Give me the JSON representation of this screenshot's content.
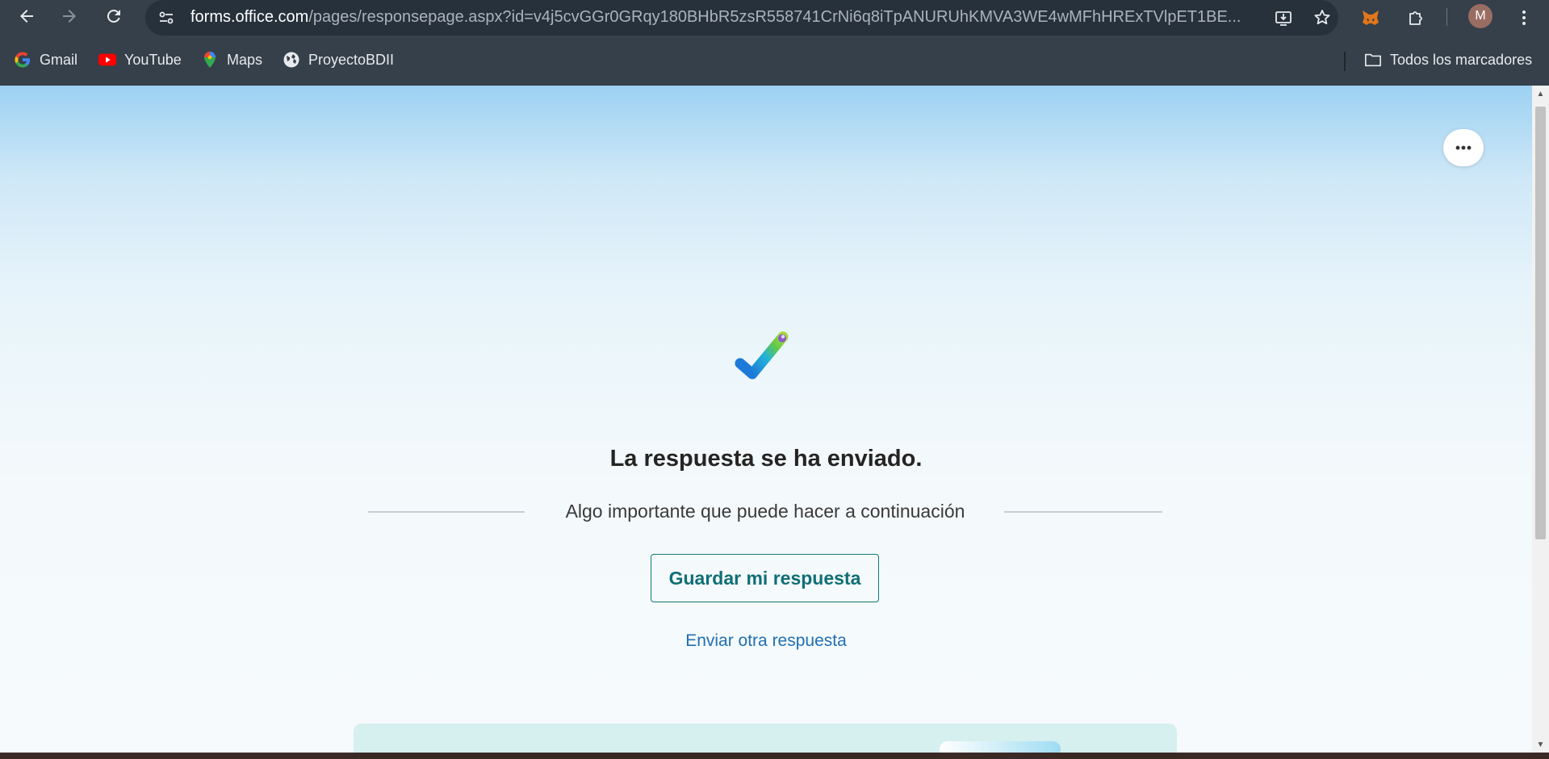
{
  "browser": {
    "url_host": "forms.office.com",
    "url_path": "/pages/responsepage.aspx?id=v4j5cvGGr0GRqy180BHbR5zsR558741CrNi6q8iTpANURUhKMVA3WE4wMFhHRExTVlpET1BE...",
    "profile_initial": "M",
    "icons": [
      "back-icon",
      "forward-icon",
      "reload-icon",
      "site-info-icon",
      "install-app-icon",
      "star-icon",
      "metamask-icon",
      "extensions-icon",
      "chrome-menu-icon"
    ]
  },
  "bookmarks": {
    "items": [
      {
        "label": "Gmail",
        "icon": "google-icon"
      },
      {
        "label": "YouTube",
        "icon": "youtube-icon"
      },
      {
        "label": "Maps",
        "icon": "maps-icon"
      },
      {
        "label": "ProyectoBDII",
        "icon": "globe-icon"
      }
    ],
    "all_bookmarks": "Todos los marcadores"
  },
  "page": {
    "heading": "La respuesta se ha enviado.",
    "subheading": "Algo importante que puede hacer a continuación",
    "save_button": "Guardar mi respuesta",
    "send_another": "Enviar otra respuesta"
  },
  "colors": {
    "accent_teal": "#0f6f75",
    "link_blue": "#1f6fb5",
    "chrome_bg": "#35404a"
  }
}
